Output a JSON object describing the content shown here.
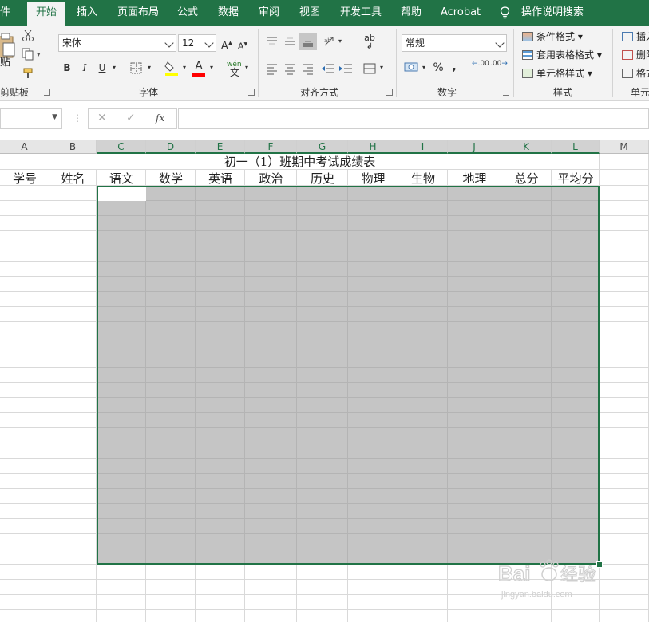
{
  "tabs": [
    "件",
    "开始",
    "插入",
    "页面布局",
    "公式",
    "数据",
    "审阅",
    "视图",
    "开发工具",
    "帮助",
    "Acrobat",
    "操作说明搜索"
  ],
  "ribbon": {
    "clipboard": {
      "paste_label": "贴",
      "group_label": "剪贴板"
    },
    "font": {
      "font_name": "宋体",
      "font_size": "12",
      "grow": "A",
      "shrink": "A",
      "bold": "B",
      "italic": "I",
      "underline": "U",
      "font_color_glyph": "A",
      "phonetic": "wén",
      "group_label": "字体",
      "fill_color": "#ffff00",
      "text_color": "#ff0000"
    },
    "alignment": {
      "group_label": "对齐方式",
      "wrap_glyph": "ab"
    },
    "number": {
      "format": "常规",
      "percent": "%",
      "comma": ",",
      "group_label": "数字",
      "inc_decimal": ".00",
      "dec_decimal": ".00"
    },
    "styles": {
      "conditional": "条件格式",
      "table": "套用表格格式",
      "cell": "单元格样式",
      "group_label": "样式"
    },
    "cells": {
      "insert": "插入",
      "delete": "删除",
      "format": "格式",
      "group_label": "单元"
    }
  },
  "formula_bar": {
    "name_box": "",
    "cancel": "✕",
    "enter": "✓",
    "fx": "fx",
    "content": ""
  },
  "columns": [
    "A",
    "B",
    "C",
    "D",
    "E",
    "F",
    "G",
    "H",
    "I",
    "J",
    "K",
    "L",
    "M"
  ],
  "sheet": {
    "title": "初一（1）班期中考试成绩表",
    "headers": [
      "学号",
      "姓名",
      "语文",
      "数学",
      "英语",
      "政治",
      "历史",
      "物理",
      "生物",
      "地理",
      "总分",
      "平均分"
    ]
  },
  "watermark": {
    "text": "Bai 经验",
    "sub": "jingyan.baidu.com"
  },
  "colors": {
    "accent": "#217346",
    "ribbon_bg": "#f3f3f3",
    "selection": "#bfbfbf"
  }
}
